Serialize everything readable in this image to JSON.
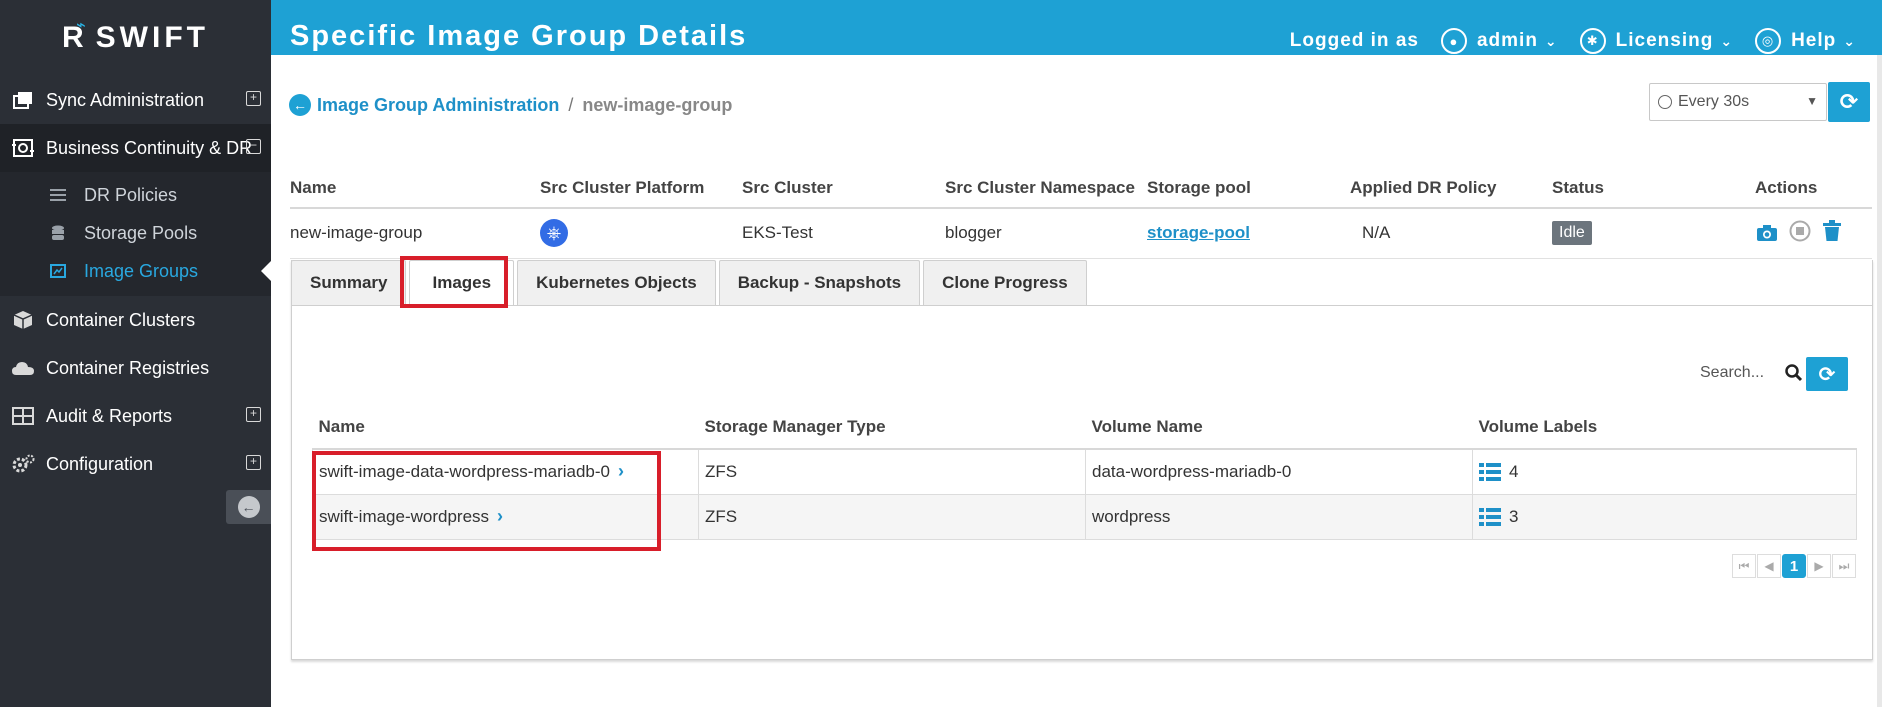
{
  "brand": {
    "logo_mark": "R",
    "name": "SWIFT"
  },
  "header": {
    "title": "Specific Image Group Details",
    "logged_in_label": "Logged in as",
    "user": "admin",
    "licensing": "Licensing",
    "help": "Help"
  },
  "sidebar": {
    "items": [
      {
        "label": "Sync Administration"
      },
      {
        "label": "Business Continuity & DR"
      },
      {
        "label": "Container Clusters"
      },
      {
        "label": "Container Registries"
      },
      {
        "label": "Audit & Reports"
      },
      {
        "label": "Configuration"
      }
    ],
    "subitems": [
      {
        "label": "DR Policies"
      },
      {
        "label": "Storage Pools"
      },
      {
        "label": "Image Groups"
      }
    ]
  },
  "breadcrumb": {
    "parent": "Image Group Administration",
    "separator": "/",
    "current": "new-image-group"
  },
  "refresh": {
    "selected": "Every 30s"
  },
  "group_table": {
    "headers": [
      "Name",
      "Src Cluster Platform",
      "Src Cluster",
      "Src Cluster Namespace",
      "Storage pool",
      "Applied DR Policy",
      "Status",
      "Actions"
    ],
    "row": {
      "name": "new-image-group",
      "platform_icon": "kubernetes-icon",
      "cluster": "EKS-Test",
      "namespace": "blogger",
      "storage_pool": "storage-pool",
      "dr_policy": "N/A",
      "status": "Idle"
    }
  },
  "tabs": [
    "Summary",
    "Images",
    "Kubernetes Objects",
    "Backup - Snapshots",
    "Clone Progress"
  ],
  "images": {
    "search_placeholder": "Search...",
    "headers": [
      "Name",
      "Storage Manager Type",
      "Volume Name",
      "Volume Labels"
    ],
    "rows": [
      {
        "name": "swift-image-data-wordpress-mariadb-0",
        "type": "ZFS",
        "volume": "data-wordpress-mariadb-0",
        "labels": "4"
      },
      {
        "name": "swift-image-wordpress",
        "type": "ZFS",
        "volume": "wordpress",
        "labels": "3"
      }
    ]
  },
  "pagination": {
    "current": "1"
  },
  "colors": {
    "accent": "#1ea1d4",
    "sidebar_bg": "#2b2f36",
    "highlight": "#d81e2a",
    "status_idle": "#6c757d"
  }
}
